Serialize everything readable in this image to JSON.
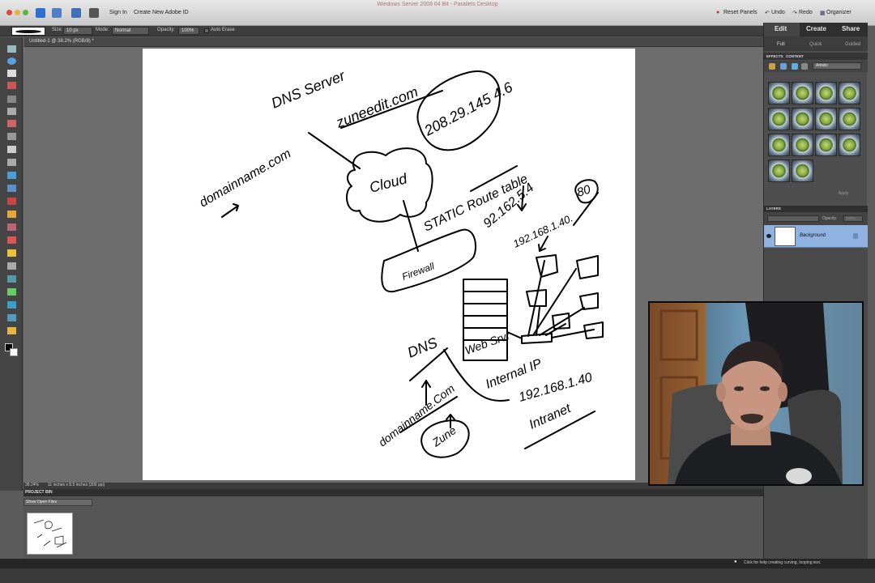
{
  "window": {
    "title": "Windows Server 2008 64 Bit - Parallels Desktop",
    "sign_in": "Sign In",
    "create_id": "Create New Adobe ID",
    "reset_panels": "Reset Panels",
    "undo": "Undo",
    "redo": "Redo",
    "organizer": "Organizer"
  },
  "options": {
    "size_label": "Size:",
    "size_value": "10 px",
    "mode_label": "Mode:",
    "mode_value": "Normal",
    "opacity_label": "Opacity:",
    "opacity_value": "100%",
    "auto_erase": "Auto Erase"
  },
  "document": {
    "tab_label": "Untitled-1 @ 38.2% (RGB/8) *"
  },
  "status": {
    "zoom": "38.24%",
    "doc_size": "11 inches x 8.5 inches (300 ppi)"
  },
  "project_bin": {
    "title": "PROJECT BIN",
    "show_select": "Show Open Files"
  },
  "hint": "Click for help creating curving, looping text.",
  "panel": {
    "tabs": [
      "Edit",
      "Create",
      "Share"
    ],
    "subtabs": [
      "Full",
      "Quick",
      "Guided"
    ],
    "effects_tabs": [
      "EFFECTS",
      "CONTENT"
    ],
    "effects_filter": "Artistic",
    "apply": "Apply",
    "layers_title": "LAYERS",
    "layer_opacity_label": "Opacity:",
    "layer_opacity_value": "100%",
    "layer_name": "Background"
  },
  "whiteboard_text": {
    "dns_server": "DNS Server",
    "domain": "zuneedit.com",
    "ip_public": "208.29.145 4.6",
    "domainname": "domainname.com",
    "cloud": "Cloud",
    "firewall": "Firewall",
    "static_route": "STATIC Route table",
    "ip_route": "92.162.5.4",
    "ip_local": "192.168.1.40.",
    "port": "80",
    "dns": "DNS",
    "web_server": "Web Srvr",
    "internal_ip": "Internal IP",
    "ip_internal": "192.168.1.40",
    "intranet": "Intranet",
    "domainname2": "domainname.Com",
    "zune": "Zune"
  }
}
